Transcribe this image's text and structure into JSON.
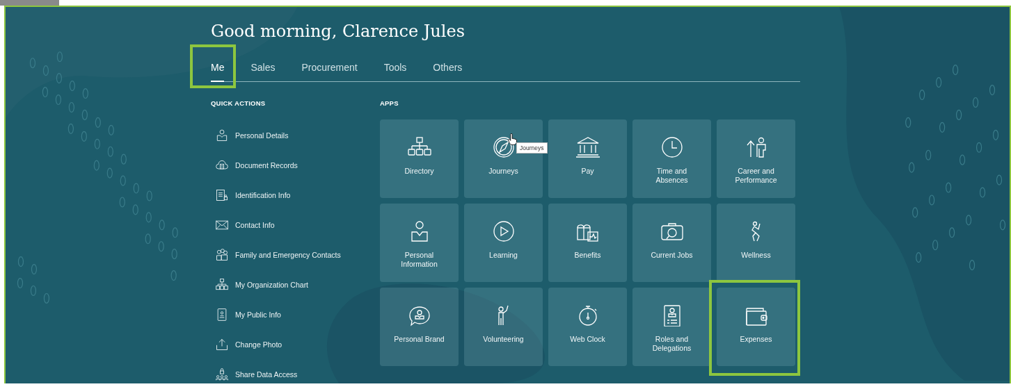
{
  "greeting": "Good morning, Clarence Jules",
  "tabs": [
    {
      "label": "Me",
      "selected": true,
      "highlighted": true
    },
    {
      "label": "Sales",
      "selected": false,
      "highlighted": false
    },
    {
      "label": "Procurement",
      "selected": false,
      "highlighted": false
    },
    {
      "label": "Tools",
      "selected": false,
      "highlighted": false
    },
    {
      "label": "Others",
      "selected": false,
      "highlighted": false
    }
  ],
  "quick_actions": {
    "title": "QUICK ACTIONS",
    "items": [
      {
        "label": "Personal Details"
      },
      {
        "label": "Document Records"
      },
      {
        "label": "Identification Info"
      },
      {
        "label": "Contact Info"
      },
      {
        "label": "Family and Emergency Contacts"
      },
      {
        "label": "My Organization Chart"
      },
      {
        "label": "My Public Info"
      },
      {
        "label": "Change Photo"
      },
      {
        "label": "Share Data Access"
      }
    ]
  },
  "apps": {
    "title": "APPS",
    "items": [
      {
        "label": "Directory",
        "highlighted": false
      },
      {
        "label": "Journeys",
        "highlighted": false,
        "tooltip": "Journeys"
      },
      {
        "label": "Pay",
        "highlighted": false
      },
      {
        "label": "Time and Absences",
        "highlighted": false
      },
      {
        "label": "Career and Performance",
        "highlighted": false
      },
      {
        "label": "Personal Information",
        "highlighted": false
      },
      {
        "label": "Learning",
        "highlighted": false
      },
      {
        "label": "Benefits",
        "highlighted": false
      },
      {
        "label": "Current Jobs",
        "highlighted": false
      },
      {
        "label": "Wellness",
        "highlighted": false
      },
      {
        "label": "Personal Brand",
        "highlighted": false
      },
      {
        "label": "Volunteering",
        "highlighted": false
      },
      {
        "label": "Web Clock",
        "highlighted": false
      },
      {
        "label": "Roles and Delegations",
        "highlighted": false
      },
      {
        "label": "Expenses",
        "highlighted": true
      }
    ]
  }
}
